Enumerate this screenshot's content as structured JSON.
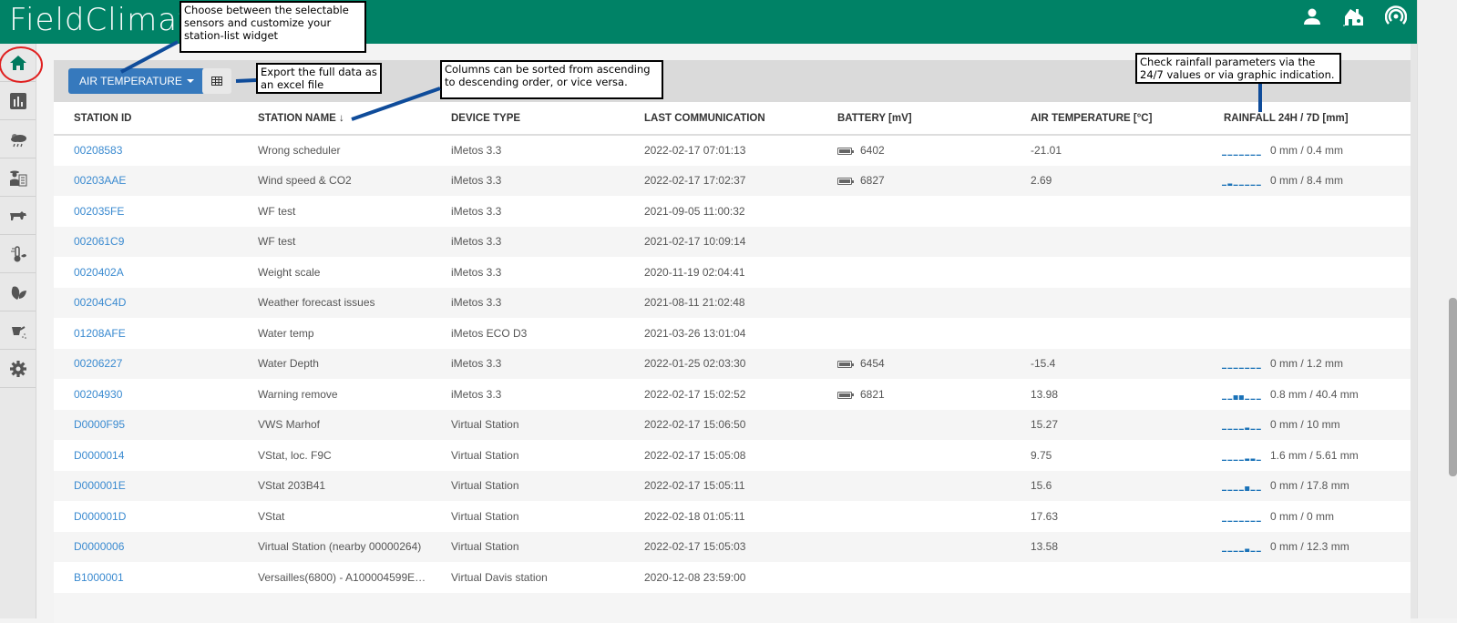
{
  "app": {
    "logo_text": "FieldClimate",
    "top_icons": [
      "user-icon",
      "farm-icon",
      "signal-icon"
    ]
  },
  "sidebar": {
    "items": [
      {
        "name": "home",
        "icon": "home-icon",
        "active": true
      },
      {
        "name": "charts",
        "icon": "bar-chart-icon"
      },
      {
        "name": "weather",
        "icon": "weather-cloud-icon"
      },
      {
        "name": "farmer",
        "icon": "farmer-list-icon"
      },
      {
        "name": "animals",
        "icon": "animals-icon"
      },
      {
        "name": "disease",
        "icon": "thermometer-leaf-icon"
      },
      {
        "name": "crops",
        "icon": "leaves-icon"
      },
      {
        "name": "irrigation",
        "icon": "watering-can-icon"
      },
      {
        "name": "settings",
        "icon": "gear-icon"
      }
    ]
  },
  "toolbar": {
    "sensor_button_label": "AIR TEMPERATURE",
    "export_icon": "table-grid-icon"
  },
  "callouts": {
    "sensors": "Choose between the selectable sensors and customize your station-list widget",
    "sensors_lines": [
      "Choose between the selectable",
      "sensors and customize your",
      "station-list widget"
    ],
    "export_lines": [
      "Export the full data as",
      "an excel file"
    ],
    "sort_lines": [
      "Columns can be sorted from ascending",
      "to descending order, or vice versa."
    ],
    "rainfall_lines": [
      "Check rainfall parameters via the",
      "24/7 values or via graphic indication."
    ]
  },
  "table": {
    "columns": [
      "STATION ID",
      "STATION NAME",
      "DEVICE TYPE",
      "LAST COMMUNICATION",
      "BATTERY [mV]",
      "AIR TEMPERATURE [°C]",
      "RAINFALL 24H / 7D [mm]"
    ],
    "sort_indicator": "↓",
    "rows": [
      {
        "id": "00208583",
        "name": "Wrong scheduler",
        "device": "iMetos 3.3",
        "last": "2022-02-17 07:01:13",
        "battery": "6402",
        "temp": "-21.01",
        "rain": "0 mm / 0.4 mm",
        "spark": [
          0,
          0,
          0,
          0,
          0,
          0,
          0
        ]
      },
      {
        "id": "00203AAE",
        "name": "Wind speed & CO2",
        "device": "iMetos 3.3",
        "last": "2022-02-17 17:02:37",
        "battery": "6827",
        "temp": "2.69",
        "rain": "0 mm / 8.4 mm",
        "spark": [
          0,
          1,
          0,
          0,
          0,
          0,
          0
        ]
      },
      {
        "id": "002035FE",
        "name": "WF test",
        "device": "iMetos 3.3",
        "last": "2021-09-05 11:00:32",
        "battery": "",
        "temp": "",
        "rain": "",
        "spark": null
      },
      {
        "id": "002061C9",
        "name": "WF test",
        "device": "iMetos 3.3",
        "last": "2021-02-17 10:09:14",
        "battery": "",
        "temp": "",
        "rain": "",
        "spark": null
      },
      {
        "id": "0020402A",
        "name": "Weight scale",
        "device": "iMetos 3.3",
        "last": "2020-11-19 02:04:41",
        "battery": "",
        "temp": "",
        "rain": "",
        "spark": null
      },
      {
        "id": "00204C4D",
        "name": "Weather forecast issues",
        "device": "iMetos 3.3",
        "last": "2021-08-11 21:02:48",
        "battery": "",
        "temp": "",
        "rain": "",
        "spark": null
      },
      {
        "id": "01208AFE",
        "name": "Water temp",
        "device": "iMetos ECO D3",
        "last": "2021-03-26 13:01:04",
        "battery": "",
        "temp": "",
        "rain": "",
        "spark": null
      },
      {
        "id": "00206227",
        "name": "Water Depth",
        "device": "iMetos 3.3",
        "last": "2022-01-25 02:03:30",
        "battery": "6454",
        "temp": "-15.4",
        "rain": "0 mm / 1.2 mm",
        "spark": [
          0,
          0,
          0,
          0,
          0,
          0,
          0
        ]
      },
      {
        "id": "00204930",
        "name": "Warning remove",
        "device": "iMetos 3.3",
        "last": "2022-02-17 15:02:52",
        "battery": "6821",
        "temp": "13.98",
        "rain": "0.8 mm / 40.4 mm",
        "spark": [
          0,
          0,
          3,
          3,
          0,
          0,
          0
        ]
      },
      {
        "id": "D0000F95",
        "name": "VWS Marhof",
        "device": "Virtual Station",
        "last": "2022-02-17 15:06:50",
        "battery": "",
        "temp": "15.27",
        "rain": "0 mm / 10 mm",
        "spark": [
          0,
          0,
          0,
          0,
          1,
          0,
          0
        ]
      },
      {
        "id": "D0000014",
        "name": "VStat, loc. F9C",
        "device": "Virtual Station",
        "last": "2022-02-17 15:05:08",
        "battery": "",
        "temp": "9.75",
        "rain": "1.6 mm / 5.61 mm",
        "spark": [
          0,
          0,
          0,
          0,
          1,
          1,
          0
        ]
      },
      {
        "id": "D000001E",
        "name": "VStat 203B41",
        "device": "Virtual Station",
        "last": "2022-02-17 15:05:11",
        "battery": "",
        "temp": "15.6",
        "rain": "0 mm / 17.8 mm",
        "spark": [
          0,
          0,
          0,
          0,
          3,
          0,
          0
        ]
      },
      {
        "id": "D000001D",
        "name": "VStat",
        "device": "Virtual Station",
        "last": "2022-02-18 01:05:11",
        "battery": "",
        "temp": "17.63",
        "rain": "0 mm / 0 mm",
        "spark": [
          0,
          0,
          0,
          0,
          0,
          0,
          0
        ]
      },
      {
        "id": "D0000006",
        "name": "Virtual Station (nearby 00000264)",
        "device": "Virtual Station",
        "last": "2022-02-17 15:05:03",
        "battery": "",
        "temp": "13.58",
        "rain": "0 mm / 12.3 mm",
        "spark": [
          0,
          0,
          0,
          0,
          2,
          0,
          0
        ]
      },
      {
        "id": "B1000001",
        "name": "Versailles(6800) - A100004599E…",
        "device": "Virtual Davis station",
        "last": "2020-12-08 23:59:00",
        "battery": "",
        "temp": "",
        "rain": "",
        "spark": null
      }
    ]
  },
  "colors": {
    "brand": "#008266",
    "accent": "#3679bd",
    "link": "#3a8ad0",
    "spark": "#1a72b8",
    "highlight_circle": "#e02020",
    "arrow": "#0f4c9a"
  }
}
